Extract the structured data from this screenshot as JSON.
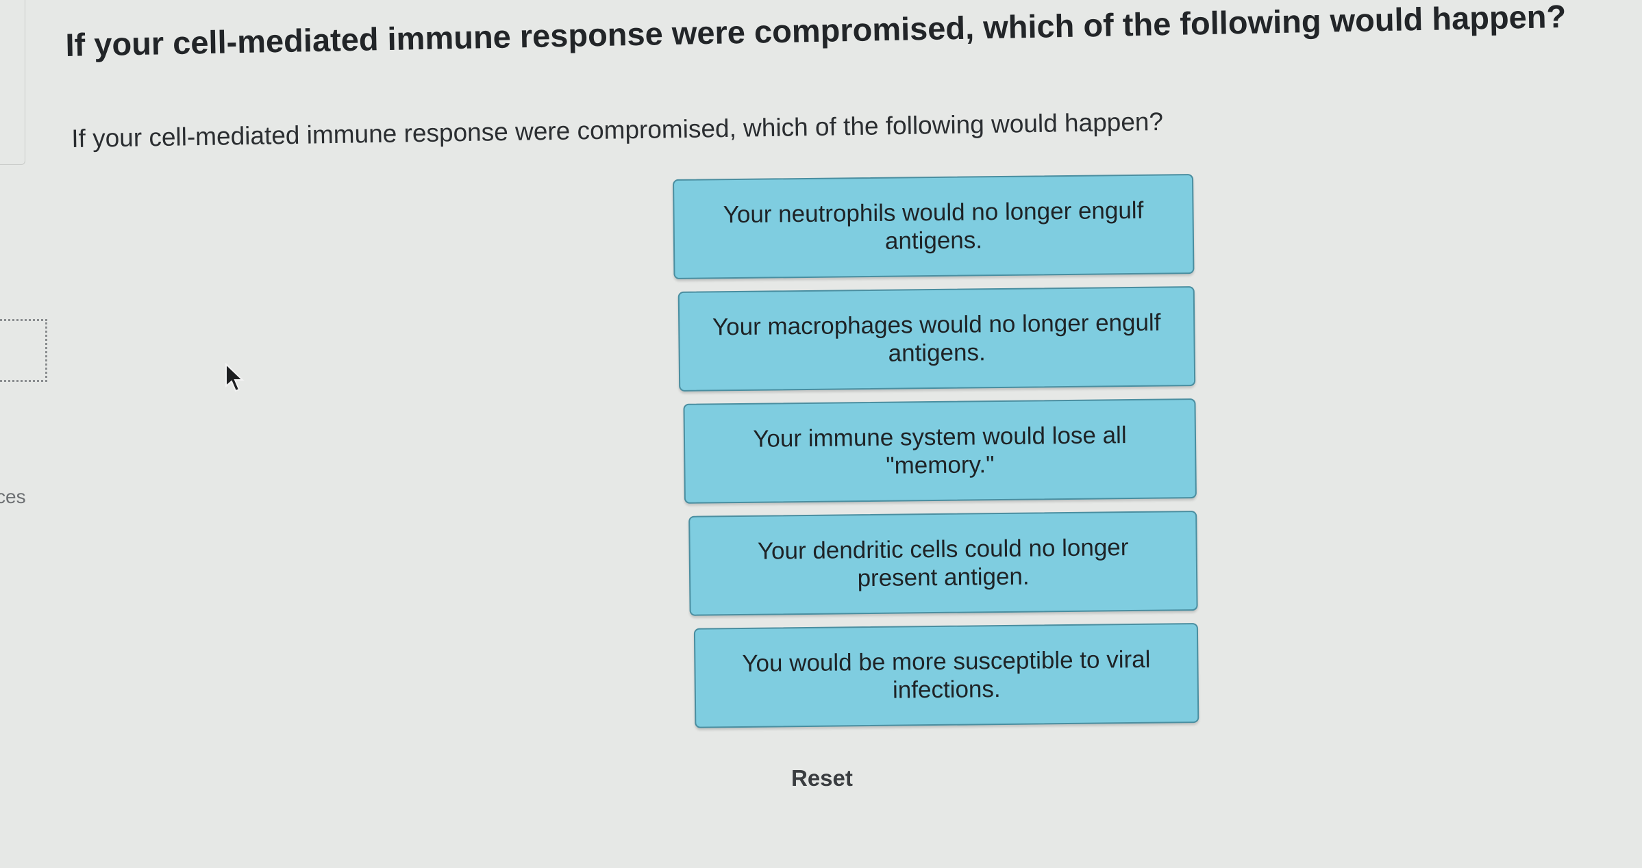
{
  "question": {
    "title": "If your cell-mediated immune response were compromised, which of the following would happen?",
    "prompt": "If your cell-mediated immune response were compromised, which of the following would happen?"
  },
  "side_label": "ces",
  "options": [
    {
      "label": "Your neutrophils would no longer engulf antigens."
    },
    {
      "label": "Your macrophages would no longer engulf antigens."
    },
    {
      "label": "Your immune system would lose all \"memory.\""
    },
    {
      "label": "Your dendritic cells could no longer present antigen."
    },
    {
      "label": "You would be more susceptible to viral infections."
    }
  ],
  "reset_label": "Reset",
  "colors": {
    "background": "#e6e8e6",
    "option_fill": "#7fcde0",
    "option_border": "#4a8ea0"
  },
  "icons": {
    "cursor": "mouse-pointer-icon"
  }
}
